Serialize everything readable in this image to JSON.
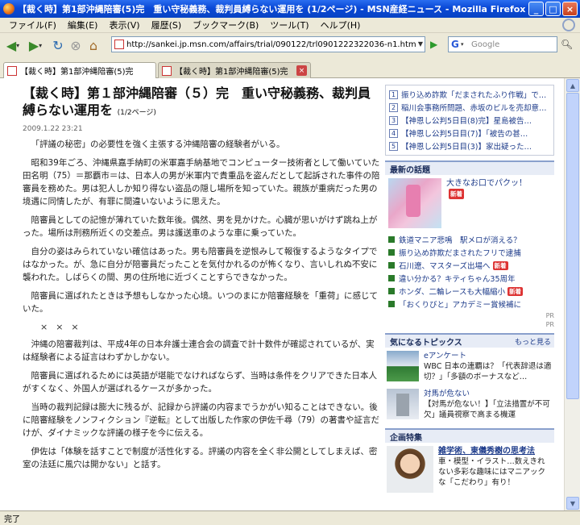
{
  "window": {
    "title": "【裁く時】第1部沖縄陪審(5)完　重い守秘義務、裁判員縛らない運用を (1/2ページ) - MSN産経ニュース - Mozilla Firefox"
  },
  "menu": [
    "ファイル(F)",
    "編集(E)",
    "表示(V)",
    "履歴(S)",
    "ブックマーク(B)",
    "ツール(T)",
    "ヘルプ(H)"
  ],
  "nav": {
    "url": "http://sankei.jp.msn.com/affairs/trial/090122/trl0901222322036-n1.htm",
    "search_placeholder": "Google"
  },
  "tabs": [
    {
      "label": "【裁く時】第1部沖縄陪審(5)完　重い守秘..."
    },
    {
      "label": "【裁く時】第1部沖縄陪審(5)完　重い..."
    }
  ],
  "article": {
    "headline": "【裁く時】第１部沖縄陪審（５）完　重い守秘義務、裁判員縛らない運用を",
    "pages": "(1/2ページ)",
    "date": "2009.1.22 23:21",
    "paragraphs": [
      "「評議の秘密」の必要性を強く主張する沖縄陪審の経験者がいる。",
      "昭和39年ごろ、沖縄県嘉手納町の米軍嘉手納基地でコンピューター技術者として働いていた田名明（75）＝那覇市＝は、日本人の男が米軍内で貴重品を盗んだとして起訴された事件の陪審員を務めた。男は犯人しか知り得ない盗品の隠し場所を知っていた。親族が重病だった男の境遇に同情したが、有罪に間違いないように思えた。",
      "陪審員としての記憶が薄れていた数年後。偶然、男を見かけた。心臓が思いがけず跳ね上がった。場所は刑務所近くの交差点。男は護送車のような車に乗っていた。",
      "自分の姿はみられていない確信はあった。男も陪審員を逆恨みして報復するようなタイプではなかった。が、急に自分が陪審員だったことを気付かれるのが怖くなり、言いしれぬ不安に襲われた。しばらくの間、男の住所地に近づくことすらできなかった。",
      "陪審員に選ばれたときは予想もしなかった心境。いつのまにか陪審経験を「重荷」に感じていた。"
    ],
    "crosses": "×××",
    "paragraphs2": [
      "沖縄の陪審裁判は、平成4年の日本弁護士連合会の調査で計十数件が確認されているが、実は経験者による証言はわずかしかない。",
      "陪審員に選ばれるためには英語が堪能でなければならず、当時は条件をクリアできた日本人がすくなく、外国人が選ばれるケースが多かった。",
      "当時の裁判記録は膨大に残るが、記録から評議の内容までうかがい知ることはできない。後に陪審経験をノンフィクション『逆転』として出版した作家の伊佐千尋（79）の著書や証言だけが、ダイナミックな評議の様子を今に伝える。",
      "伊佐は「体験を話すことで制度が活性化する。評議の内容を全く非公開としてしまえば、密室の法廷に風穴は開かない」と話す。"
    ]
  },
  "sidebar": {
    "ranking": [
      {
        "num": "1",
        "text": "振り込め詐欺「だまされたふり作戦」で…"
      },
      {
        "num": "2",
        "text": "稲川会事務所問題、赤坂のビルを売却意…"
      },
      {
        "num": "3",
        "text": "【神恩し公判5日目(8)完】星島被告…"
      },
      {
        "num": "4",
        "text": "【神恩し公判5日目(7)】「被告の甚…"
      },
      {
        "num": "5",
        "text": "【神恩し公判5日目(3)】家出疑った…"
      }
    ],
    "latest_header": "最新の話題",
    "latest_main": "大きなお口でパクッ！",
    "new_label": "新着",
    "trends": [
      {
        "text": "鉄道マニア悲鳴　駅メロが消える？",
        "new": false
      },
      {
        "text": "振り込め詐欺だまされたフリで逮捕",
        "new": false
      },
      {
        "text": "石川遼、マスターズ出場へ",
        "new": true
      },
      {
        "text": "違い分かる？キティちゃん35周年",
        "new": false
      },
      {
        "text": "ホンダ、二輪レースも大幅縮小",
        "new": true
      },
      {
        "text": "「おくりびと」アカデミー賞候補に",
        "new": false
      }
    ],
    "pr1": "PR",
    "pr2": "PR",
    "topics_header": "気になるトピックス",
    "topics_more": "もっと見る",
    "topics": [
      {
        "title": "eアンケート",
        "desc": "WBC 日本の連覇は？「代表辞退は適切？」「多額のボーナスなど…"
      },
      {
        "title": "対馬が危ない",
        "desc": "【対馬が危ない！】「立法措置が不可欠」議員視察で高まる機運"
      }
    ],
    "feature_header": "企画特集",
    "feature_title": "雑学術、東儀秀樹の思考法",
    "feature_desc": "車・模型・イラスト…数えきれない多彩な趣味にはマニアックな「こだわり」有り！"
  },
  "status": "完了"
}
